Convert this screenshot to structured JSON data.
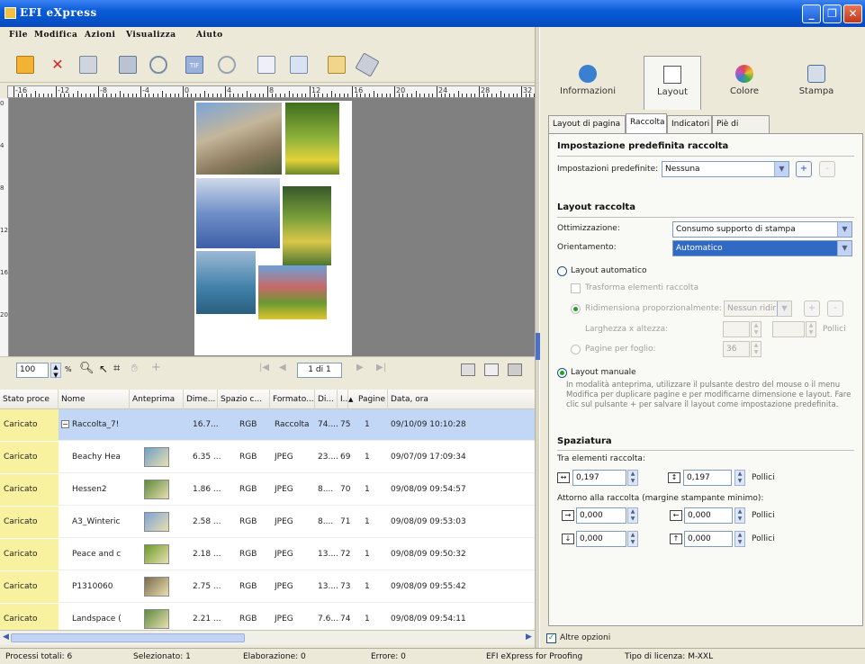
{
  "window": {
    "title": "EFI eXpress"
  },
  "menu": [
    "File",
    "Modifica",
    "Azioni",
    "Visualizza",
    "Aiuto"
  ],
  "toolbar": {
    "icons": [
      "open-icon",
      "delete-icon",
      "save-icon",
      "print-icon",
      "preview-icon",
      "tiff-icon",
      "disc-icon",
      "page-icon",
      "image-icon",
      "edit-icon",
      "wrench-icon"
    ]
  },
  "ruler": {
    "labels": [
      "-16",
      "-12",
      "-8",
      "-4",
      "0",
      "4",
      "8",
      "12",
      "16",
      "20",
      "24",
      "28",
      "32"
    ],
    "vlabels": [
      "0",
      "4",
      "8",
      "12",
      "16",
      "20"
    ]
  },
  "preview_bar": {
    "zoom": "100",
    "zoom_unit": "%",
    "page_indicator": "1 di 1"
  },
  "grid": {
    "headers": [
      "Stato proce",
      "Nome",
      "Anteprima",
      "Dime...",
      "Spazio c...",
      "Formato...",
      "Di...",
      "I...",
      "Pagine",
      "Data, ora"
    ],
    "sort_marker": "▲",
    "rows": [
      {
        "state": "Caricato",
        "name": "Raccolta_7!",
        "size": "16.7...",
        "color": "RGB",
        "format": "Raccolta",
        "di": "74....",
        "id": "75",
        "pages": "1",
        "date": "09/10/09 10:10:28",
        "selected": true,
        "expand": "−"
      },
      {
        "state": "Caricato",
        "name": "Beachy Hea",
        "size": "6.35 ...",
        "color": "RGB",
        "format": "JPEG",
        "di": "23....",
        "id": "69",
        "pages": "1",
        "date": "09/07/09 17:09:34",
        "thumb": "#6fa0c8"
      },
      {
        "state": "Caricato",
        "name": "Hessen2",
        "size": "1.86 ...",
        "color": "RGB",
        "format": "JPEG",
        "di": "8....",
        "id": "70",
        "pages": "1",
        "date": "09/08/09 09:54:57",
        "thumb": "#5c8a3a"
      },
      {
        "state": "Caricato",
        "name": "A3_Winteric",
        "size": "2.58 ...",
        "color": "RGB",
        "format": "JPEG",
        "di": "8....",
        "id": "71",
        "pages": "1",
        "date": "09/08/09 09:53:03",
        "thumb": "#7fa3d6"
      },
      {
        "state": "Caricato",
        "name": "Peace and c",
        "size": "2.18 ...",
        "color": "RGB",
        "format": "JPEG",
        "di": "13....",
        "id": "72",
        "pages": "1",
        "date": "09/08/09 09:50:32",
        "thumb": "#6c9a2a"
      },
      {
        "state": "Caricato",
        "name": "P1310060",
        "size": "2.75 ...",
        "color": "RGB",
        "format": "JPEG",
        "di": "13....",
        "id": "73",
        "pages": "1",
        "date": "09/08/09 09:55:42",
        "thumb": "#7d6a4e"
      },
      {
        "state": "Caricato",
        "name": "Landspace (",
        "size": "2.21 ...",
        "color": "RGB",
        "format": "JPEG",
        "di": "7.6....",
        "id": "74",
        "pages": "1",
        "date": "09/08/09 09:54:11",
        "thumb": "#5f8a40"
      }
    ]
  },
  "status": {
    "total": "Processi totali: 6",
    "selected": "Selezionato: 1",
    "processing": "Elaborazione: 0",
    "errors": "Errore: 0",
    "product": "EFI eXpress for Proofing",
    "license": "Tipo di licenza: M-XXL"
  },
  "right": {
    "big_tabs": [
      {
        "label": "Informazioni",
        "color": "#3a7fd0"
      },
      {
        "label": "Layout",
        "color": "#555555",
        "active": true
      },
      {
        "label": "Colore",
        "color": "#e05aa0"
      },
      {
        "label": "Stampa",
        "color": "#4a6fa8"
      }
    ],
    "subtabs": [
      "Layout di pagina",
      "Raccolta",
      "Indicatori",
      "Piè di pagina"
    ],
    "preset_section": "Impostazione predefinita raccolta",
    "preset_label": "Impostazioni predefinite:",
    "preset_value": "Nessuna",
    "plus": "+",
    "minus": "-",
    "layout_section": "Layout raccolta",
    "opt_label": "Ottimizzazione:",
    "opt_value": "Consumo supporto di stampa",
    "orient_label": "Orientamento:",
    "orient_value": "Automatico",
    "auto_layout": "Layout automatico",
    "transform": "Trasforma elementi raccolta",
    "resize": "Ridimensiona proporzionalmente:",
    "resize_value": "Nessun ridir",
    "wh": "Larghezza x altezza:",
    "units_pollici": "Pollici",
    "per_sheet": "Pagine per foglio:",
    "per_sheet_value": "36",
    "manual_layout": "Layout manuale",
    "manual_note": "In modalità anteprima, utilizzare il pulsante destro del mouse o il menu Modifica per duplicare pagine e per modificarne dimensione e layout. Fare clic sul pulsante + per salvare il layout come impostazione predefinita.",
    "spacing_section": "Spaziatura",
    "between": "Tra elementi raccolta:",
    "between_h": "0,197",
    "between_v": "0,197",
    "around": "Attorno alla raccolta (margine stampante minimo):",
    "m_left": "0,000",
    "m_right": "0,000",
    "m_top": "0,000",
    "m_bottom": "0,000",
    "more_options": "Altre opzioni",
    "check": "✓"
  }
}
